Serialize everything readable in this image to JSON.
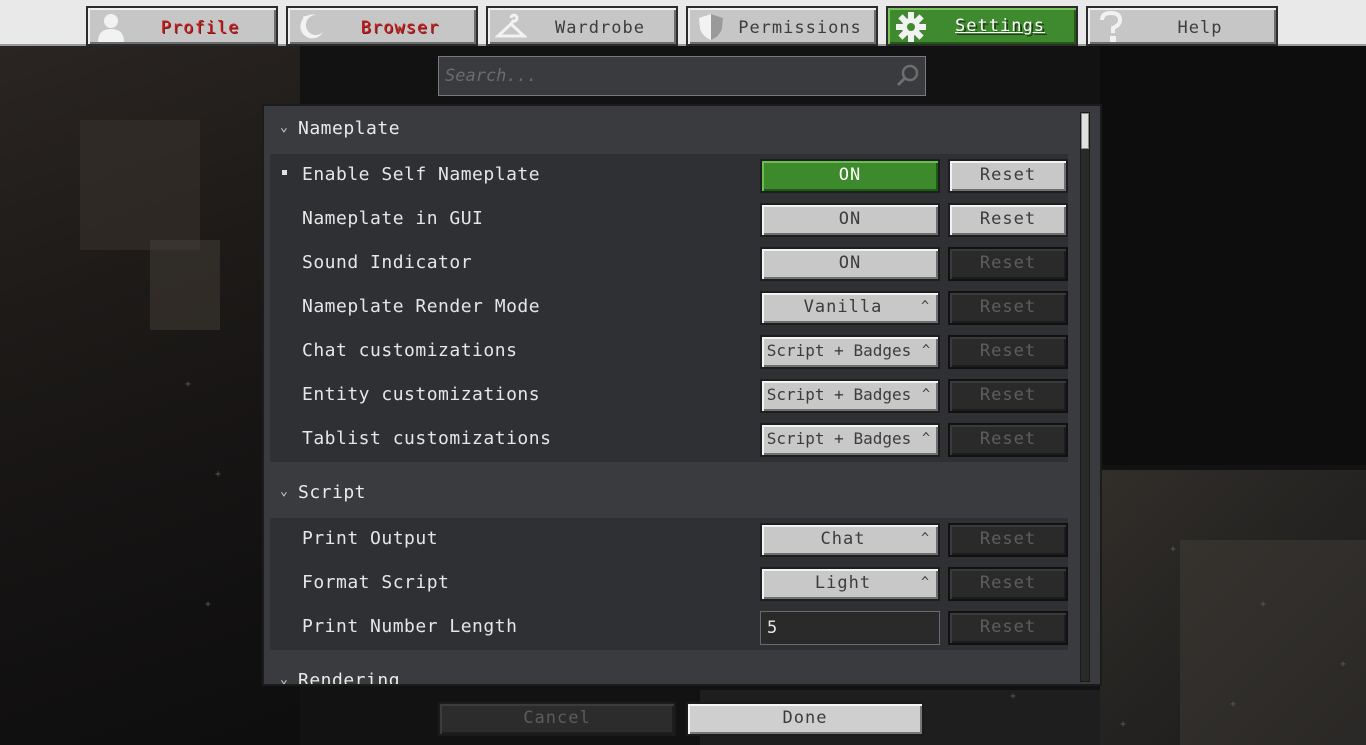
{
  "tabs": [
    {
      "label": "Profile",
      "icon": "user-icon"
    },
    {
      "label": "Browser",
      "icon": "moon-icon"
    },
    {
      "label": "Wardrobe",
      "icon": "hanger-icon"
    },
    {
      "label": "Permissions",
      "icon": "shield-icon"
    },
    {
      "label": "Settings",
      "icon": "gear-icon"
    },
    {
      "label": "Help",
      "icon": "question-icon"
    }
  ],
  "search": {
    "placeholder": "Search..."
  },
  "categories": [
    {
      "title": "Nameplate",
      "rows": [
        {
          "label": "Enable Self Nameplate",
          "value": "ON",
          "reset": "Reset"
        },
        {
          "label": "Nameplate in GUI",
          "value": "ON",
          "reset": "Reset"
        },
        {
          "label": "Sound Indicator",
          "value": "ON",
          "reset": "Reset"
        },
        {
          "label": "Nameplate Render Mode",
          "value": "Vanilla",
          "reset": "Reset"
        },
        {
          "label": "Chat customizations",
          "value": "Script + Badges",
          "reset": "Reset"
        },
        {
          "label": "Entity customizations",
          "value": "Script + Badges",
          "reset": "Reset"
        },
        {
          "label": "Tablist customizations",
          "value": "Script + Badges",
          "reset": "Reset"
        }
      ]
    },
    {
      "title": "Script",
      "rows": [
        {
          "label": "Print Output",
          "value": "Chat",
          "reset": "Reset"
        },
        {
          "label": "Format Script",
          "value": "Light",
          "reset": "Reset"
        },
        {
          "label": "Print Number Length",
          "value": "5",
          "reset": "Reset"
        }
      ]
    },
    {
      "title": "Rendering",
      "rows": []
    }
  ],
  "footer": {
    "cancel": "Cancel",
    "done": "Done"
  },
  "colors": {
    "active_tab": "#3f8a2e",
    "toggle_on": "#3d8a2c",
    "tab_red_text": "#c21c1c"
  }
}
